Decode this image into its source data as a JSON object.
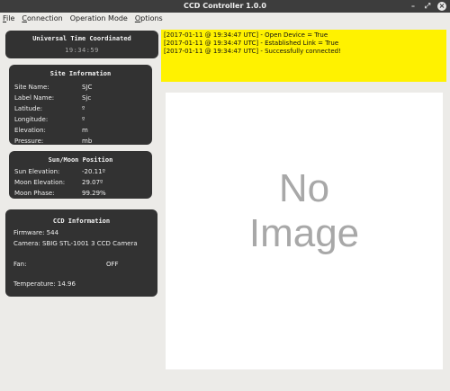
{
  "window": {
    "title": "CCD Controller 1.0.0",
    "minimize_glyph": "–",
    "maximize_glyph": "⤢",
    "close_glyph": "×"
  },
  "menu": {
    "items": [
      {
        "accel": "F",
        "rest": "ile"
      },
      {
        "accel": "C",
        "rest": "onnection"
      },
      {
        "accel": "",
        "rest": "Operation Mode"
      },
      {
        "accel": "O",
        "rest": "ptions"
      }
    ]
  },
  "utc": {
    "title": "Universal Time Coordinated",
    "time": "19:34:59"
  },
  "site": {
    "title": "Site Information",
    "rows": [
      {
        "label": "Site Name:",
        "value": "SJC"
      },
      {
        "label": "Label Name:",
        "value": "Sjc"
      },
      {
        "label": "Latitude:",
        "value": "º"
      },
      {
        "label": "Longitude:",
        "value": "º"
      },
      {
        "label": "Elevation:",
        "value": "m"
      },
      {
        "label": "Pressure:",
        "value": "mb"
      }
    ]
  },
  "sunmoon": {
    "title": "Sun/Moon Position",
    "rows": [
      {
        "label": "Sun Elevation:",
        "value": "-20.11º"
      },
      {
        "label": "Moon Elevation:",
        "value": "29.07º"
      },
      {
        "label": "Moon Phase:",
        "value": "99.29%"
      }
    ]
  },
  "ccd": {
    "title": "CCD Information",
    "firmware": "Firmware: 544",
    "camera": "Camera: SBIG STL-1001 3 CCD Camera",
    "fan_label": "Fan:",
    "fan_value": "OFF",
    "temperature": "Temperature:  14.96"
  },
  "log": {
    "lines": [
      "[2017-01-11 @ 19:34:47 UTC] - Open Device = True",
      "[2017-01-11 @ 19:34:47 UTC] - Established Link = True",
      "[2017-01-11 @ 19:34:47 UTC] - Successfully connected!"
    ],
    "background": "#fff200"
  },
  "image_view": {
    "line1": "No",
    "line2": "Image"
  }
}
